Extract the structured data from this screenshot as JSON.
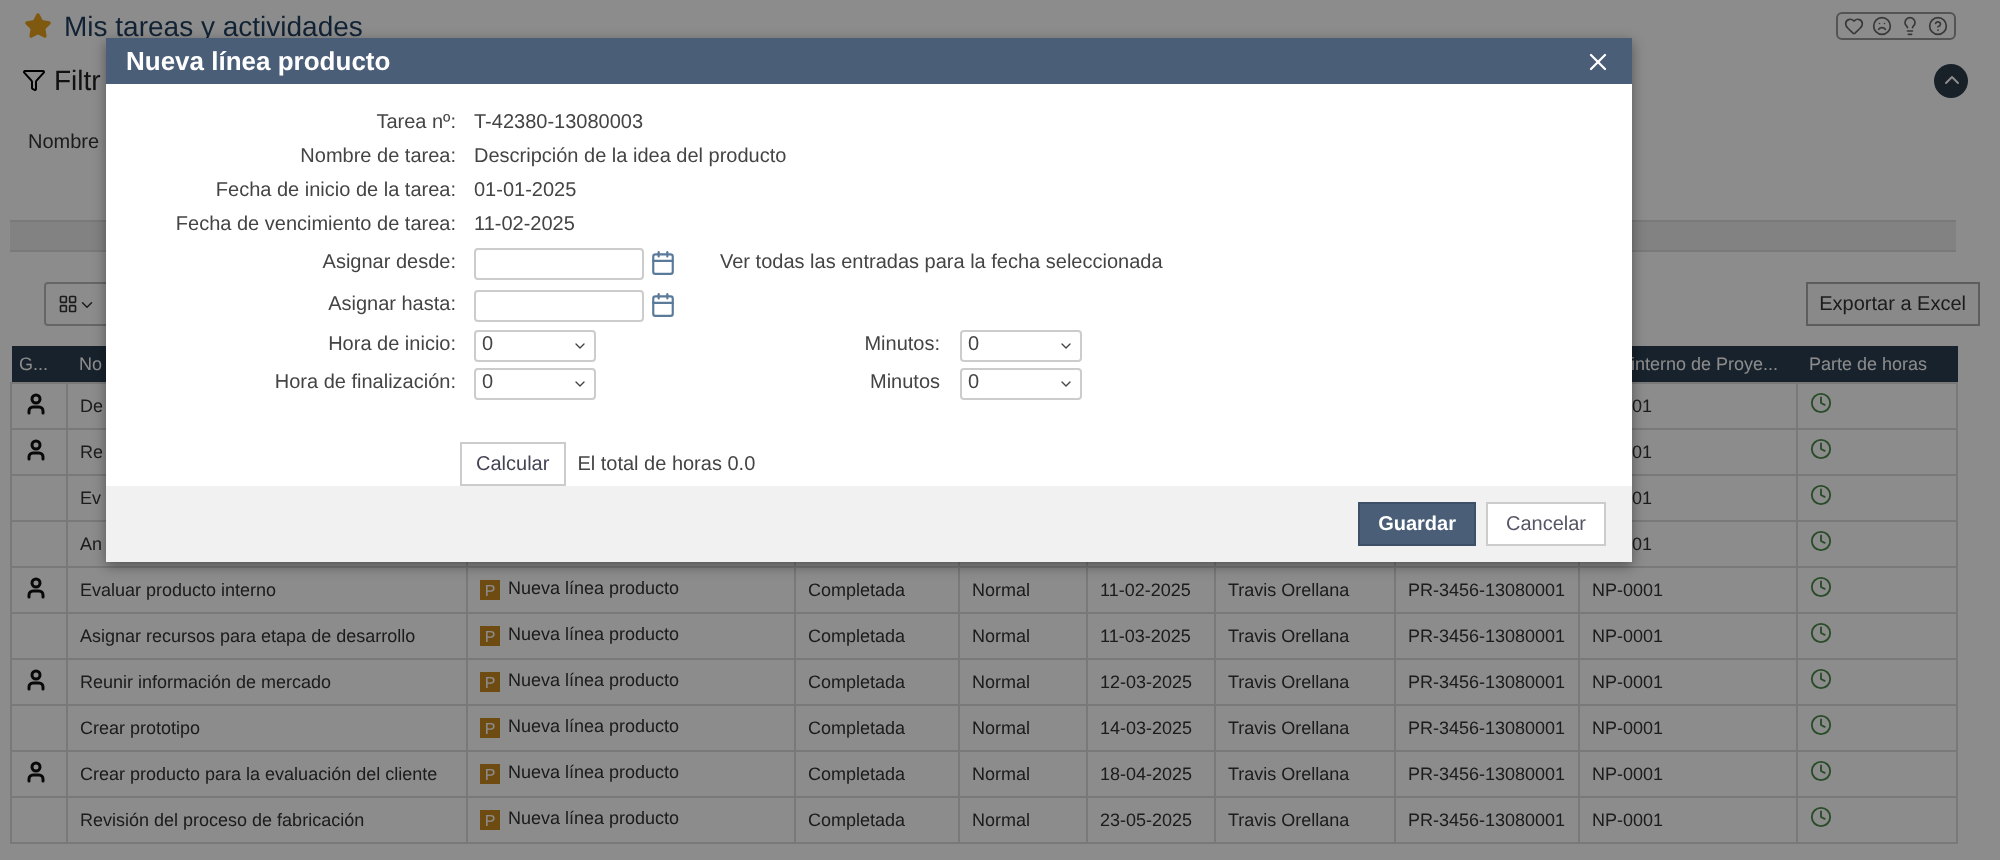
{
  "page": {
    "title": "Mis tareas y actividades",
    "filter_title": "Filtr",
    "filter_label": "Nombre"
  },
  "toolbar": {
    "export_button": "Exportar a Excel"
  },
  "table": {
    "header": {
      "column_1": "G...",
      "column_2": "No",
      "column_9": "interno de Proye...",
      "column_10": "Parte de horas"
    },
    "rows": [
      {
        "person_mark": true,
        "name": "De",
        "internal_id": "01"
      },
      {
        "person_mark": true,
        "name": "Re",
        "internal_id": "01"
      },
      {
        "person_mark": false,
        "name": "Ev",
        "internal_id": "01"
      },
      {
        "person_mark": false,
        "name": "An",
        "internal_id": "01"
      },
      {
        "person_mark": true,
        "name": "Evaluar producto interno",
        "project_badge": "P",
        "project": "Nueva línea producto",
        "status": "Completada",
        "priority": "Normal",
        "date": "11-02-2025",
        "assignee": "Travis Orellana",
        "project_code": "PR-3456-13080001",
        "internal_id": "NP-0001"
      },
      {
        "person_mark": false,
        "name": "Asignar recursos para etapa de desarrollo",
        "project_badge": "P",
        "project": "Nueva línea producto",
        "status": "Completada",
        "priority": "Normal",
        "date": "11-03-2025",
        "assignee": "Travis Orellana",
        "project_code": "PR-3456-13080001",
        "internal_id": "NP-0001"
      },
      {
        "person_mark": true,
        "name": "Reunir información de mercado",
        "project_badge": "P",
        "project": "Nueva línea producto",
        "status": "Completada",
        "priority": "Normal",
        "date": "12-03-2025",
        "assignee": "Travis Orellana",
        "project_code": "PR-3456-13080001",
        "internal_id": "NP-0001"
      },
      {
        "person_mark": false,
        "name": "Crear prototipo",
        "project_badge": "P",
        "project": "Nueva línea producto",
        "status": "Completada",
        "priority": "Normal",
        "date": "14-03-2025",
        "assignee": "Travis Orellana",
        "project_code": "PR-3456-13080001",
        "internal_id": "NP-0001"
      },
      {
        "person_mark": true,
        "name": "Crear producto para la evaluación del cliente",
        "project_badge": "P",
        "project": "Nueva línea producto",
        "status": "Completada",
        "priority": "Normal",
        "date": "18-04-2025",
        "assignee": "Travis Orellana",
        "project_code": "PR-3456-13080001",
        "internal_id": "NP-0001"
      },
      {
        "person_mark": false,
        "name": "Revisión del proceso de fabricación",
        "project_badge": "P",
        "project": "Nueva línea producto",
        "status": "Completada",
        "priority": "Normal",
        "date": "23-05-2025",
        "assignee": "Travis Orellana",
        "project_code": "PR-3456-13080001",
        "internal_id": "NP-0001"
      }
    ]
  },
  "dialog": {
    "title": "Nueva línea producto",
    "form": [
      {
        "kind": "text",
        "label": "Tarea nº:",
        "value": "T-42380-13080003"
      },
      {
        "kind": "text",
        "label": "Nombre de tarea:",
        "value": "Descripción de la idea del producto"
      },
      {
        "kind": "text",
        "label": "Fecha de inicio de la tarea:",
        "value": "01-01-2025"
      },
      {
        "kind": "text",
        "label": "Fecha de vencimiento de tarea:",
        "value": "11-02-2025"
      },
      {
        "kind": "date",
        "label": "Asignar desde:",
        "note": "Ver todas las entradas para la fecha seleccionada"
      },
      {
        "kind": "date",
        "label": "Asignar hasta:"
      },
      {
        "kind": "time",
        "label": "Hora de inicio:",
        "value": "0",
        "minutes_label": "Minutos:",
        "minutes_value": "0"
      },
      {
        "kind": "time",
        "label": "Hora de finalización:",
        "value": "0",
        "minutes_label": "Minutos",
        "minutes_value": "0"
      }
    ],
    "calculate_button": "Calcular",
    "total": "El total de horas 0.0",
    "buttons": [
      {
        "label": "Guardar",
        "primary": true
      },
      {
        "label": "Cancelar",
        "primary": false
      }
    ]
  }
}
